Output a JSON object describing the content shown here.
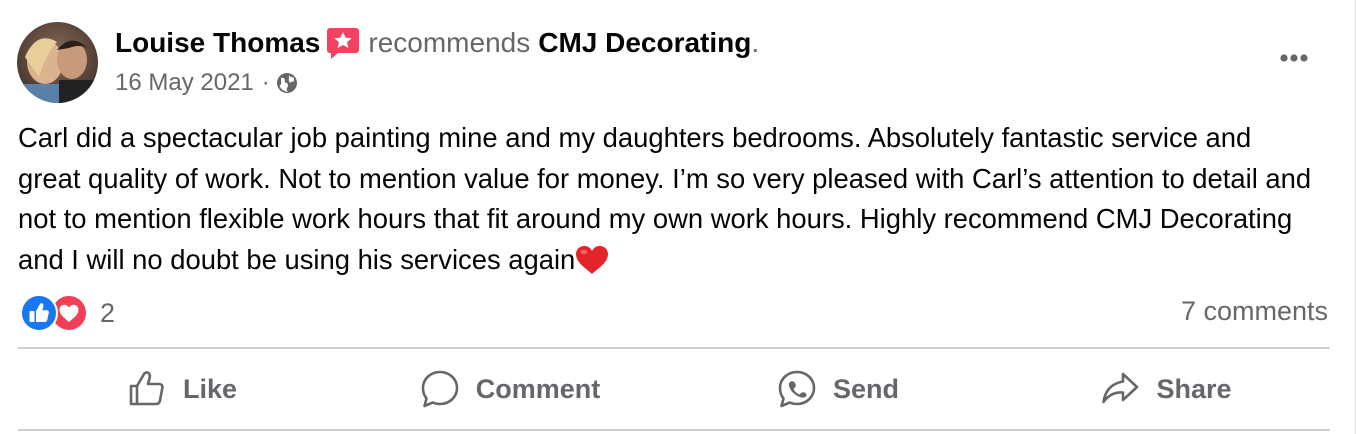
{
  "post": {
    "author": "Louise Thomas",
    "action_text": "recommends",
    "page_name": "CMJ Decorating",
    "end_punct": ".",
    "date": "16 May 2021",
    "meta_separator": "·",
    "privacy_icon": "globe-icon",
    "badge_icon": "recommendation-star-icon",
    "more_icon": "more-dots-icon",
    "body": "Carl did a spectacular job painting mine and my daughters bedrooms. Absolutely fantastic service and great quality of work. Not to mention value for money. I’m so very pleased with Carl’s attention to detail and not to mention flexible work hours that fit around my own work hours. Highly recommend CMJ Decorating and I will no doubt be using his services again",
    "body_emoji": "heart-emoji"
  },
  "reactions": {
    "icons": [
      "like-reaction-icon",
      "love-reaction-icon"
    ],
    "count": "2"
  },
  "comments": {
    "label": "7 comments"
  },
  "actions": {
    "like": {
      "label": "Like",
      "icon": "thumbs-up-icon"
    },
    "comment": {
      "label": "Comment",
      "icon": "comment-bubble-icon"
    },
    "send": {
      "label": "Send",
      "icon": "messenger-icon"
    },
    "share": {
      "label": "Share",
      "icon": "share-arrow-icon"
    }
  },
  "colors": {
    "text_primary": "#050505",
    "text_secondary": "#65676b",
    "like_blue": "#1877f2",
    "love_red": "#f33e58",
    "badge_pink": "#f3425f",
    "divider": "#ced0d4"
  }
}
